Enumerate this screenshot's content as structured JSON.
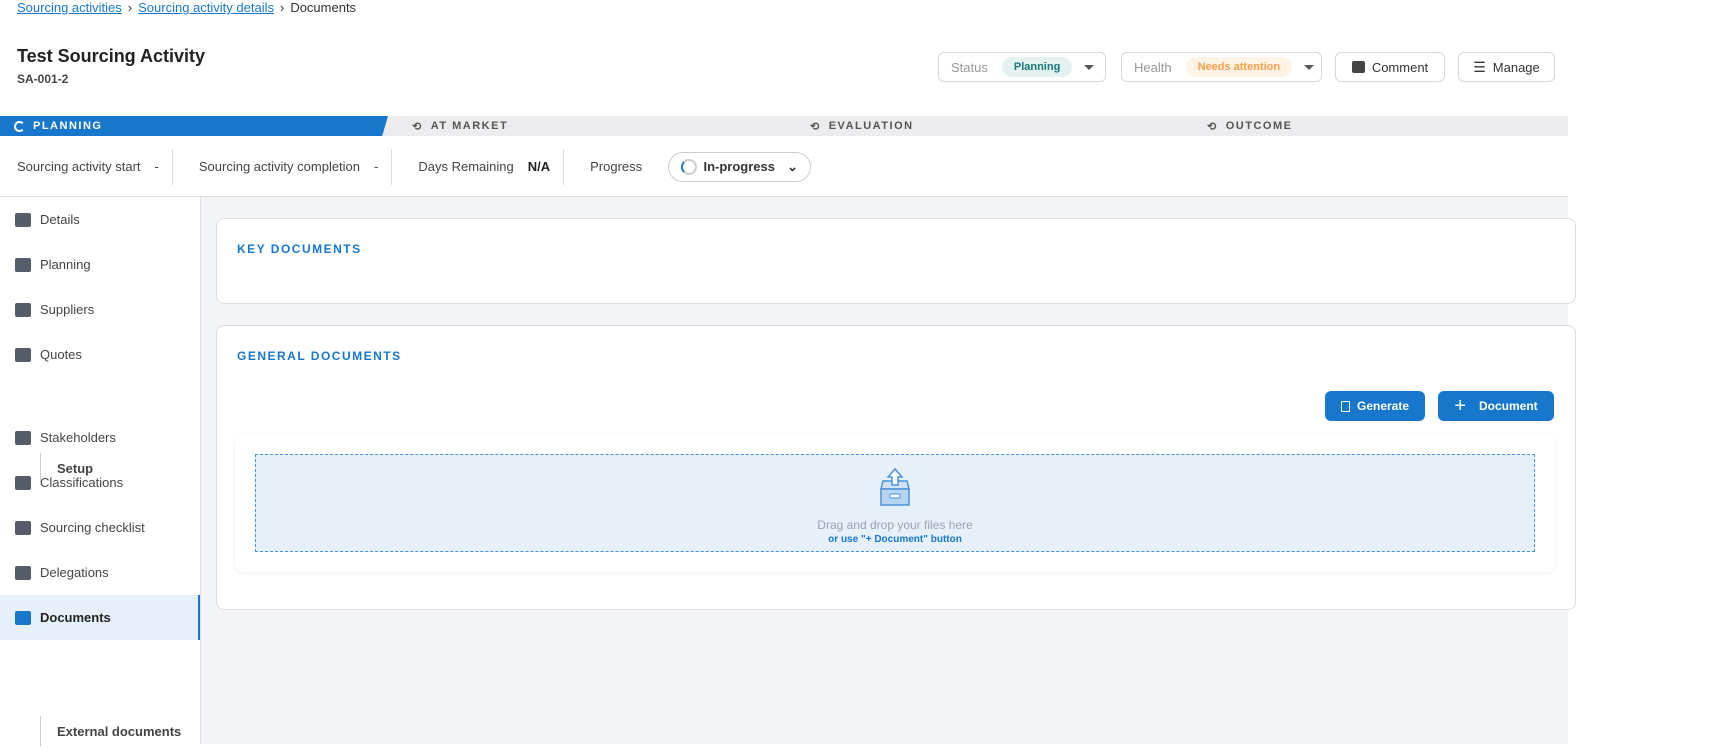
{
  "breadcrumb": {
    "items": [
      "Sourcing activities",
      "Sourcing activity details"
    ],
    "current": "Documents"
  },
  "header": {
    "title": "Test Sourcing Activity",
    "id": "SA-001-2",
    "status_label": "Status",
    "status_value": "Planning",
    "health_label": "Health",
    "health_value": "Needs attention",
    "comment_label": "Comment",
    "manage_label": "Manage"
  },
  "stages": [
    "PLANNING",
    "AT MARKET",
    "EVALUATION",
    "OUTCOME"
  ],
  "info": {
    "start_label": "Sourcing activity start",
    "start_value": "-",
    "completion_label": "Sourcing activity completion",
    "completion_value": "-",
    "days_label": "Days Remaining",
    "days_value": "N/A",
    "progress_label": "Progress",
    "progress_value": "In-progress"
  },
  "sidebar": {
    "items": [
      "Details",
      "Planning",
      "Suppliers",
      "Quotes",
      "Setup",
      "Stakeholders",
      "Classifications",
      "Sourcing checklist",
      "Delegations",
      "Documents",
      "External documents"
    ]
  },
  "main": {
    "key_title": "KEY DOCUMENTS",
    "general_title": "GENERAL DOCUMENTS",
    "generate_label": "Generate",
    "document_label": "Document",
    "drop_text": "Drag and drop your files here",
    "drop_hint": "or use \"+ Document\" button"
  },
  "colors": {
    "accent": "#1677cc",
    "status_bg": "#e4f1f1",
    "status_fg": "#167a7a",
    "health_bg": "#fff3e6",
    "health_fg": "#f5a04a"
  }
}
